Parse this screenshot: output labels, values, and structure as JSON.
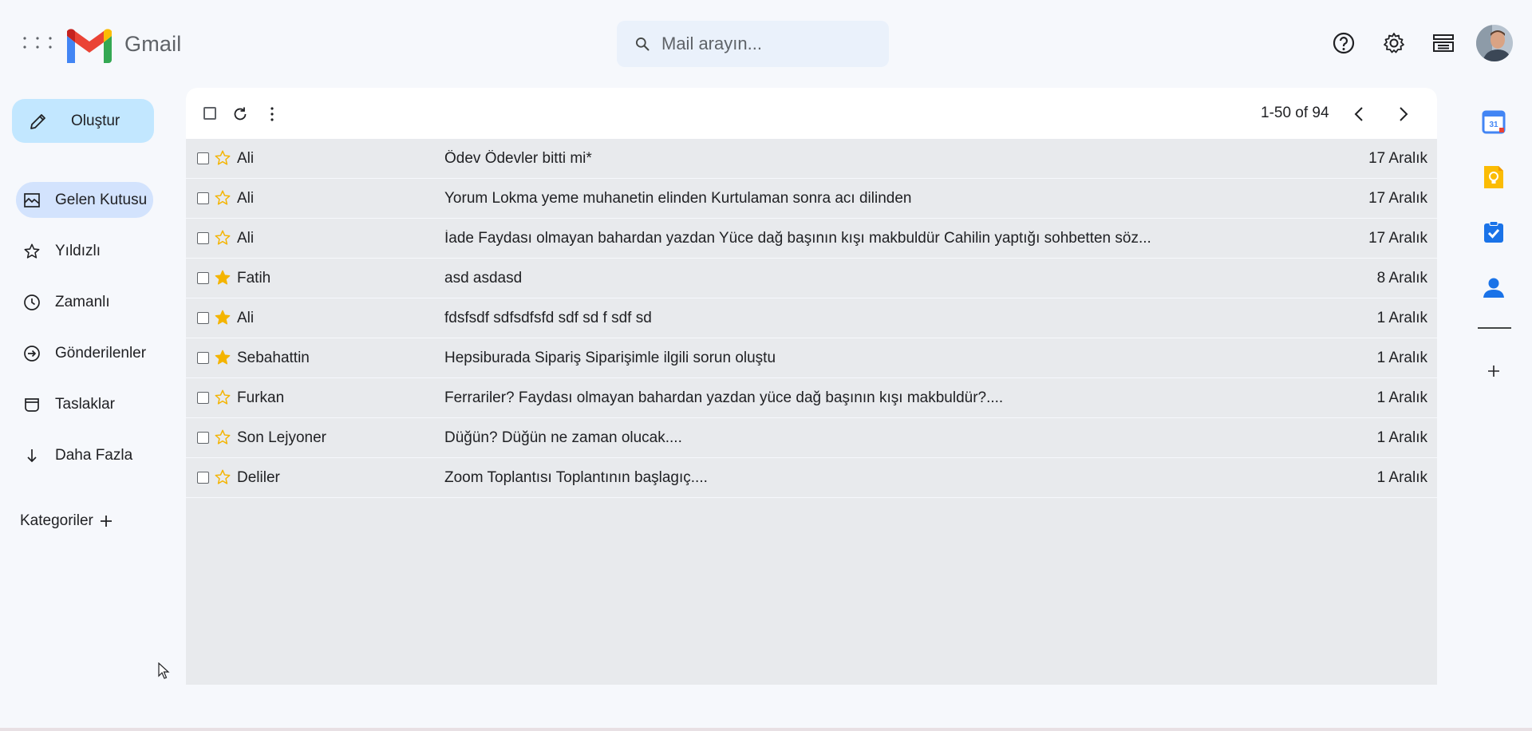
{
  "header": {
    "logo_text": "Gmail",
    "search_placeholder": "Mail arayın...",
    "icons": [
      "apps-icon",
      "help-icon",
      "settings-icon",
      "layout-icon",
      "avatar"
    ]
  },
  "sidebar": {
    "compose_label": "Oluştur",
    "items": [
      {
        "label": "Gelen Kutusu",
        "icon": "inbox-icon",
        "active": true
      },
      {
        "label": "Yıldızlı",
        "icon": "star-icon"
      },
      {
        "label": "Zamanlı",
        "icon": "clock-icon"
      },
      {
        "label": "Gönderilenler",
        "icon": "send-icon"
      },
      {
        "label": "Taslaklar",
        "icon": "draft-icon"
      },
      {
        "label": "Daha Fazla",
        "icon": "arrow-down-icon"
      }
    ],
    "categories_label": "Kategoriler"
  },
  "toolbar": {
    "pager_text": "1-50 of 94"
  },
  "emails": [
    {
      "sender": "Ali",
      "subject": "Ödev Ödevler bitti mi*",
      "date": "17 Aralık",
      "starred": false
    },
    {
      "sender": "Ali",
      "subject": "Yorum Lokma yeme muhanetin elinden Kurtulaman sonra acı dilinden",
      "date": "17 Aralık",
      "starred": false
    },
    {
      "sender": "Ali",
      "subject": "İade Faydası olmayan bahardan yazdan Yüce dağ başının kışı makbuldür Cahilin yaptığı sohbetten söz...",
      "date": "17 Aralık",
      "starred": false
    },
    {
      "sender": "Fatih",
      "subject": "asd asdasd",
      "date": "8 Aralık",
      "starred": true
    },
    {
      "sender": "Ali",
      "subject": "fdsfsdf sdfsdfsfd sdf sd f sdf sd",
      "date": "1 Aralık",
      "starred": true
    },
    {
      "sender": "Sebahattin",
      "subject": "Hepsiburada Sipariş Siparişimle ilgili sorun oluştu",
      "date": "1 Aralık",
      "starred": true
    },
    {
      "sender": "Furkan",
      "subject": "Ferrariler? Faydası olmayan bahardan yazdan yüce dağ başının kışı makbuldür?....",
      "date": "1 Aralık",
      "starred": false
    },
    {
      "sender": "Son Lejyoner",
      "subject": "Düğün? Düğün ne zaman olucak....",
      "date": "1 Aralık",
      "starred": false
    },
    {
      "sender": "Deliler",
      "subject": "Zoom Toplantısı Toplantının başlagıç....",
      "date": "1 Aralık",
      "starred": false
    }
  ],
  "side_panel": {
    "calendar_day": "31",
    "apps": [
      "calendar-icon",
      "keep-icon",
      "tasks-icon",
      "contacts-icon",
      "add-app-icon"
    ]
  },
  "colors": {
    "accent": "#c2e7ff",
    "active_nav": "#d3e3fd",
    "star": "#f4b400",
    "row_bg": "#e8eaed",
    "page_bg": "#f6f8fc"
  }
}
